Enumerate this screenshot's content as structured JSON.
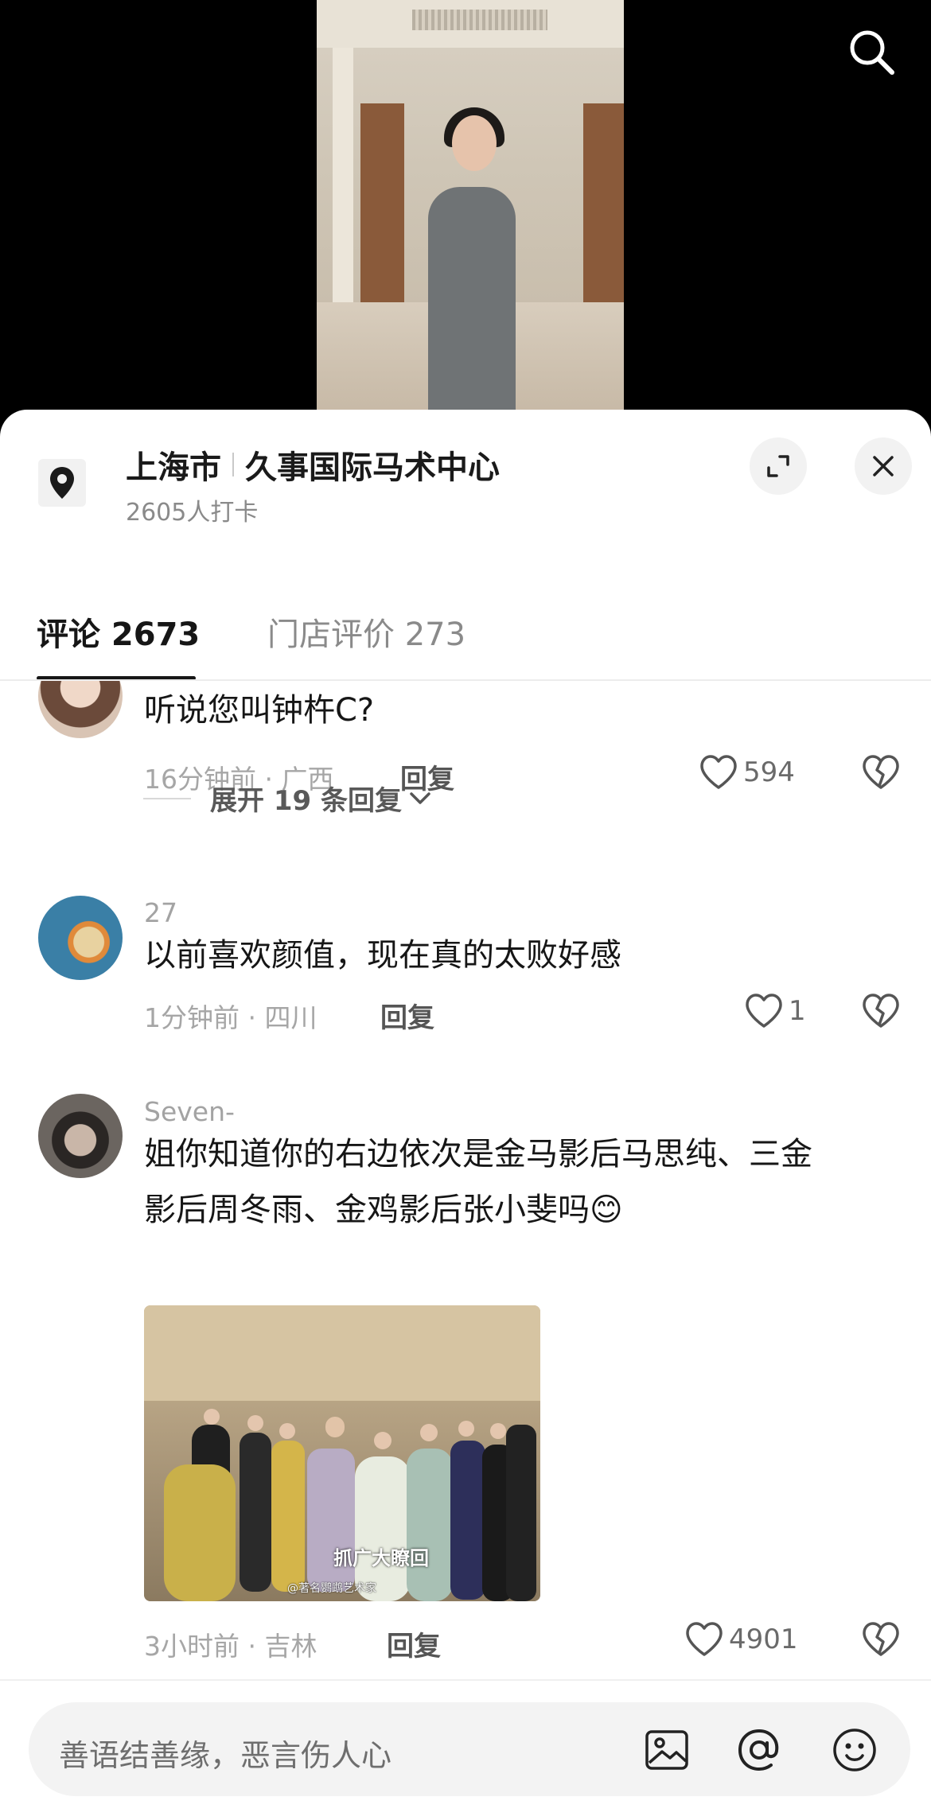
{
  "location": {
    "city": "上海市",
    "venue": "久事国际马术中心",
    "checkins": "2605人打卡"
  },
  "tabs": {
    "comments": "评论 2673",
    "reviews": "门店评价 273"
  },
  "comments": [
    {
      "text": "听说您叫钟杵C?",
      "meta": "16分钟前 · 广西",
      "reply": "回复",
      "likes": "594",
      "expand": "展开 19 条回复"
    },
    {
      "user": "27",
      "text": "以前喜欢颜值，现在真的太败好感",
      "meta": "1分钟前 · 四川",
      "reply": "回复",
      "likes": "1"
    },
    {
      "user": "Seven-",
      "text_line1": "姐你知道你的右边依次是金马影后马思纯、三金",
      "text_line2": "影后周冬雨、金鸡影后张小斐吗",
      "emoji": "😊",
      "meta": "3小时前 · 吉林",
      "reply": "回复",
      "likes": "4901",
      "image_caption": "抓广大瞭回",
      "image_watermark": "@著名鹦鹉艺术家"
    }
  ],
  "input": {
    "placeholder": "善语结善缘，恶言伤人心"
  },
  "icons": {
    "search": "search-icon",
    "pin": "location-pin-icon",
    "expand": "expand-icon",
    "close": "close-icon",
    "heart": "heart-icon",
    "broken_heart": "broken-heart-icon",
    "chevron": "chevron-down-icon",
    "image": "image-icon",
    "at": "at-icon",
    "emoji": "emoji-icon"
  }
}
